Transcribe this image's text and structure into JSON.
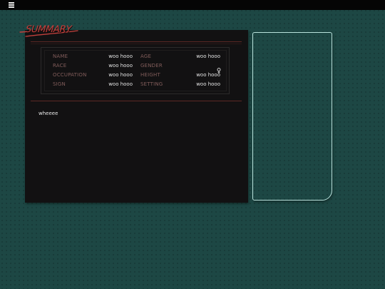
{
  "nav": {
    "menu_icon": "hamburger-menu-icon"
  },
  "summary": {
    "title": "SUMMARY",
    "stats": {
      "name_label": "NAME",
      "name_value": "woo hooo",
      "race_label": "RACE",
      "race_value": "woo hooo",
      "occupation_label": "OCCUPATION",
      "occupation_value": "woo hooo",
      "sign_label": "SIGN",
      "sign_value": "woo hooo",
      "age_label": "AGE",
      "age_value": "woo hooo",
      "gender_label": "GENDER",
      "gender_icon": "female-symbol-icon",
      "height_label": "HEIGHT",
      "height_value": "woo hooo",
      "setting_label": "SETTING",
      "setting_value": "woo hooo"
    },
    "body": "wheeee"
  },
  "colors": {
    "background": "#1d4744",
    "card": "#121112",
    "title_accent": "#c2403c",
    "label": "#825d5b",
    "value": "#e2e2e2",
    "frame_border": "#b9e3dd"
  }
}
